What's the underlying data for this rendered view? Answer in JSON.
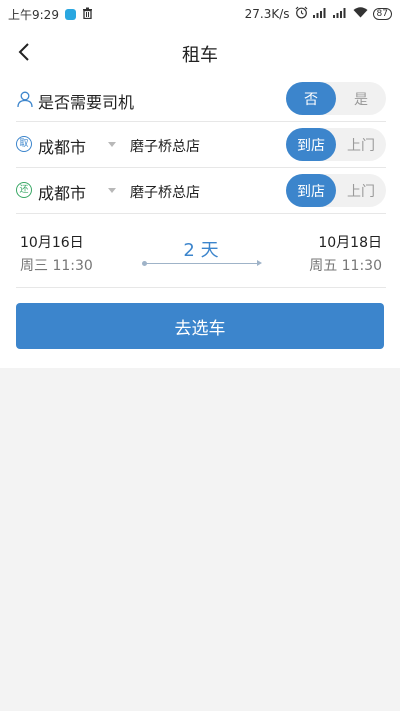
{
  "status_bar": {
    "time": "上午9:29",
    "speed": "27.3K/s",
    "battery": "87",
    "icons": [
      "app-icon",
      "trash-icon",
      "alarm-icon",
      "signal-icon",
      "signal-hd-icon",
      "wifi-icon",
      "battery-icon"
    ]
  },
  "header": {
    "title": "租车",
    "back_icon": "back-arrow-icon"
  },
  "driver": {
    "label": "是否需要司机",
    "icon": "person-icon",
    "options": [
      "否",
      "是"
    ],
    "selected": "否"
  },
  "pickup": {
    "badge": "取",
    "city": "成都市",
    "store": "磨子桥总店",
    "options": [
      "到店",
      "上门"
    ],
    "selected": "到店"
  },
  "return": {
    "badge": "还",
    "city": "成都市",
    "store": "磨子桥总店",
    "options": [
      "到店",
      "上门"
    ],
    "selected": "到店"
  },
  "dates": {
    "start_date": "10月16日",
    "start_time": "周三 11:30",
    "duration": "2 天",
    "end_date": "10月18日",
    "end_time": "周五 11:30"
  },
  "actions": {
    "select_car": "去选车"
  },
  "colors": {
    "accent": "#3c85cc",
    "return_badge": "#3aa866"
  }
}
